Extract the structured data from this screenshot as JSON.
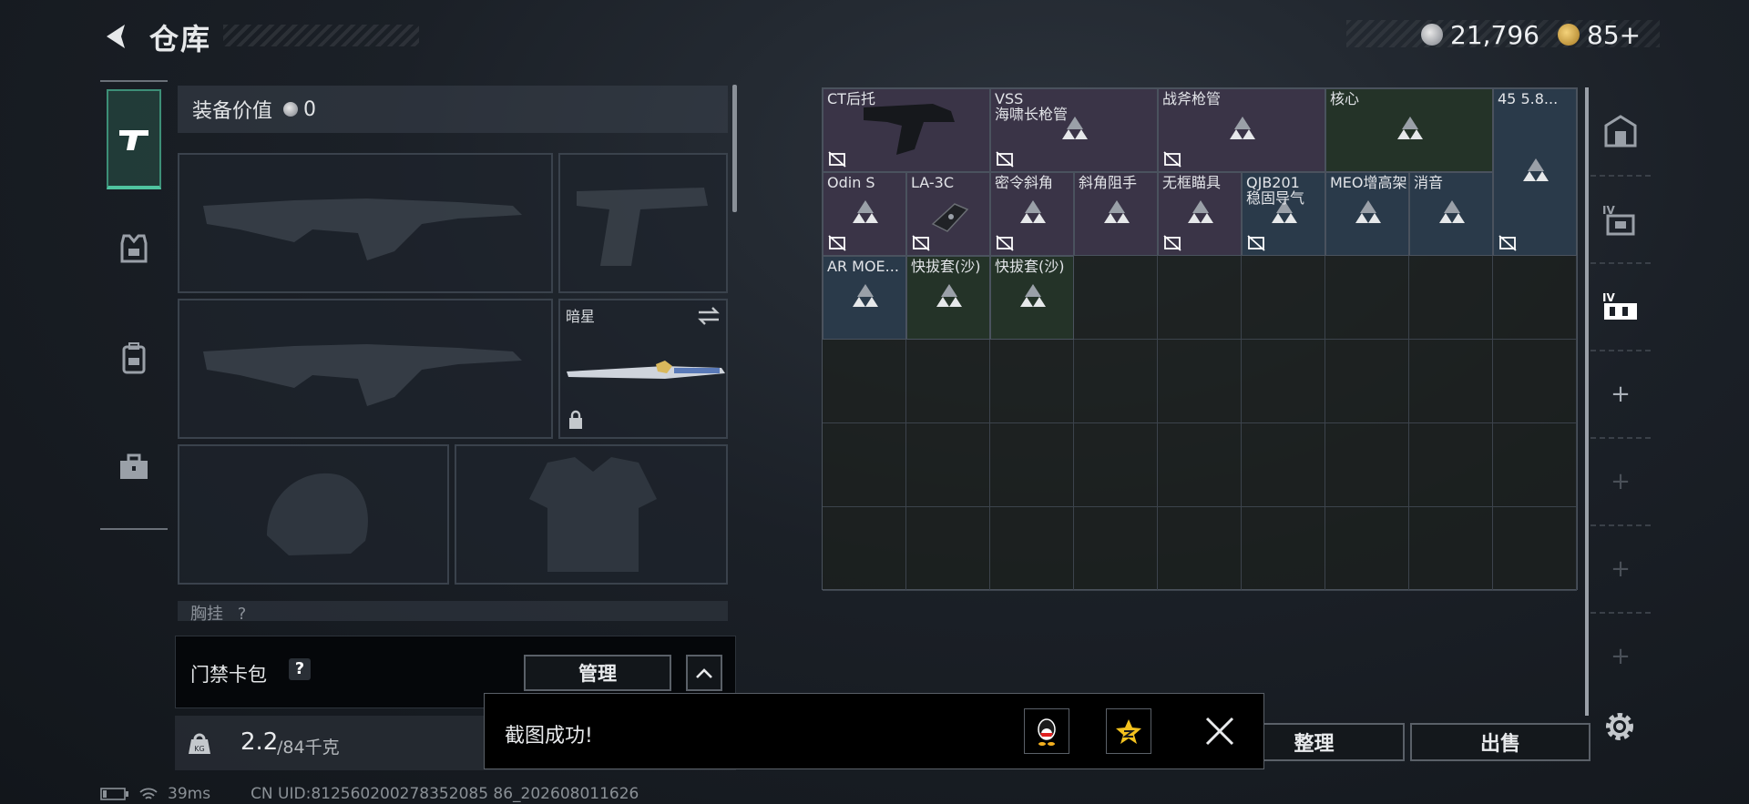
{
  "header": {
    "title": "仓库",
    "currency_1": "21,796",
    "currency_2": "85+"
  },
  "equipment": {
    "value_label": "装备价值",
    "value": "0",
    "melee_name": "暗星",
    "chest_label": "胸挂",
    "chest_hint": "?"
  },
  "card_pack": {
    "label": "门禁卡包",
    "help": "?",
    "manage_label": "管理"
  },
  "weight": {
    "current": "2.2",
    "max": "/84千克"
  },
  "inventory": {
    "items": [
      {
        "label": "CT后托"
      },
      {
        "label": "VSS\n海啸长枪管"
      },
      {
        "label": "战斧枪管"
      },
      {
        "label": "核心"
      },
      {
        "label": "45 5.8..."
      },
      {
        "label": "Odin S"
      },
      {
        "label": "LA-3C"
      },
      {
        "label": "密令斜角"
      },
      {
        "label": "斜角阻手"
      },
      {
        "label": "无框瞄具"
      },
      {
        "label": "QJB201\n稳固导气"
      },
      {
        "label": "MEO增高架"
      },
      {
        "label": "消音"
      },
      {
        "label": "AR MOE..."
      },
      {
        "label": "快拔套(沙)"
      },
      {
        "label": "快拔套(沙)"
      }
    ]
  },
  "actions": {
    "sort_label": "整理",
    "sell_label": "出售"
  },
  "toast": {
    "message": "截图成功!"
  },
  "status": {
    "ping": "39ms",
    "uid": "CN UID:812560200278352085 86_202608011626"
  },
  "colors": {
    "accent": "#4fc4a0",
    "item_purple": "#3a3447",
    "item_green": "#243328",
    "item_blue": "#2a3a4a"
  }
}
